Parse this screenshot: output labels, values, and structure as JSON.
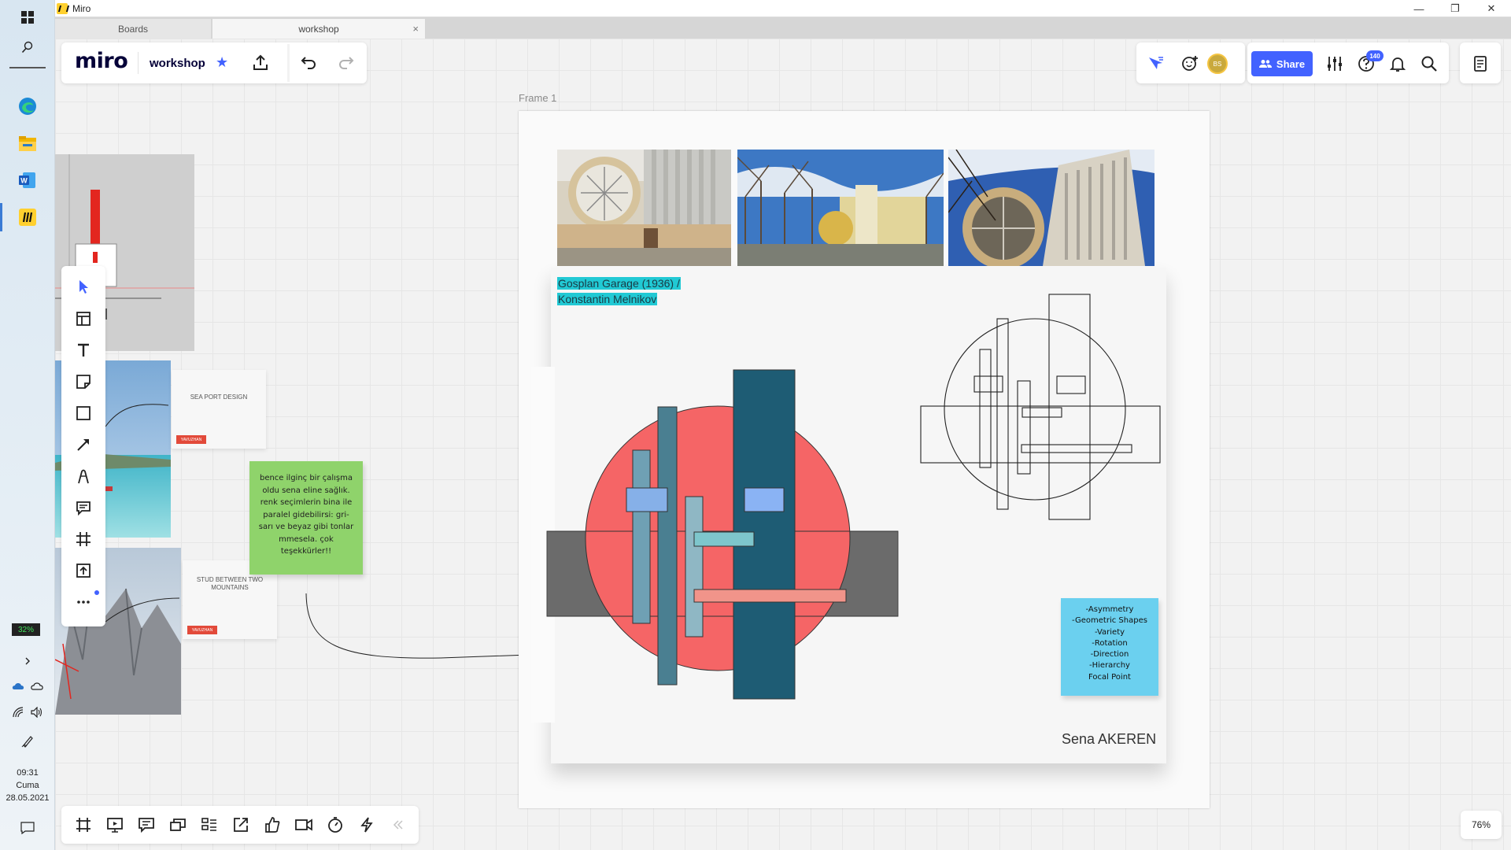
{
  "window": {
    "title": "Miro",
    "controls": [
      "—",
      "❐",
      "✕"
    ]
  },
  "tabs": [
    {
      "label": "Boards"
    },
    {
      "label": "workshop",
      "close": "×"
    }
  ],
  "header": {
    "logo": "miro",
    "board_name": "workshop",
    "avatar_initials": "BS",
    "share_label": "Share",
    "help_badge": "140"
  },
  "taskbar": {
    "battery": "32%",
    "time": "09:31",
    "day": "Cuma",
    "date": "28.05.2021"
  },
  "frame": {
    "label": "Frame 1",
    "caption_line1": "Gosplan Garage (1936) /",
    "caption_line2": "Konstantin Melnikov",
    "author": "Sena AKEREN",
    "sticky_items": [
      "-Asymmetry",
      "-Geometric Shapes",
      "-Variety",
      "-Rotation",
      "-Direction",
      "-Hierarchy",
      "Focal Point"
    ]
  },
  "side_items": {
    "sea_card_title": "SEA PORT DESIGN",
    "sea_card_tag": "YAVUZHAN",
    "stud_card_title_1": "STUD BETWEEN TWO",
    "stud_card_title_2": "MOUNTAINS",
    "stud_card_tag": "YAVUZHAN",
    "green_sticky_lines": [
      "bence ilginç bir çalışma",
      "oldu sena eline sağlık.",
      "renk seçimlerin bina ile",
      "paralel gidebilirsi: gri-",
      "sarı ve beyaz gibi tonlar",
      "mmesela. çok",
      "teşekkürler!!"
    ]
  },
  "zoom": "76%",
  "colors": {
    "accent": "#4262ff",
    "composition_red": "#f56566",
    "composition_teal": "#1e5c74",
    "composition_gray": "#6b6b6b",
    "caption_highlight": "#21c9d4",
    "blue_sticky": "#6bd0ef",
    "green_sticky": "#8fd36b"
  },
  "icons": {
    "left_toolbar": [
      "select-cursor-icon",
      "templates-icon",
      "text-icon",
      "sticky-note-icon",
      "shape-icon",
      "connection-line-icon",
      "pen-icon",
      "comment-icon",
      "frame-icon",
      "upload-icon",
      "more-icon"
    ],
    "bottom_toolbar": [
      "frames-icon",
      "present-icon",
      "comments-icon",
      "cards-icon",
      "kanban-icon",
      "share-screen-icon",
      "reactions-icon",
      "video-icon",
      "timer-icon",
      "lightning-icon",
      "collapse-icon"
    ],
    "top_right": [
      "cursor-follow-icon",
      "add-reaction-icon",
      "settings-sliders-icon",
      "help-icon",
      "bell-icon",
      "search-icon",
      "notes-icon"
    ]
  }
}
